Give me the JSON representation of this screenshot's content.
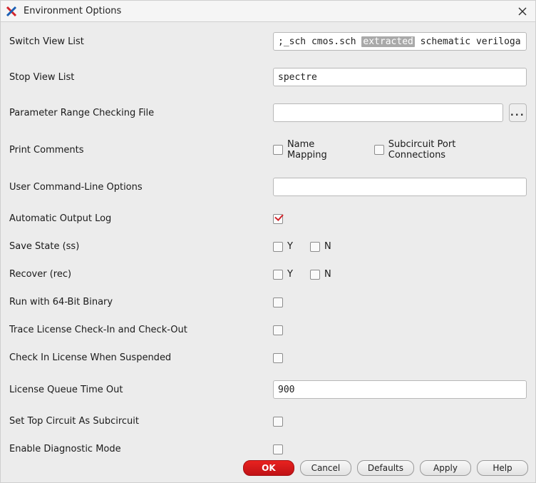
{
  "window": {
    "title": "Environment Options"
  },
  "fields": {
    "switch_view_list": {
      "label": "Switch View List",
      "prefix": ";_sch cmos.sch ",
      "selected": "extracted",
      "suffix": " schematic veriloga"
    },
    "stop_view_list": {
      "label": "Stop View List",
      "value": "spectre"
    },
    "param_range_file": {
      "label": "Parameter Range Checking File",
      "value": "",
      "browse": "..."
    },
    "print_comments": {
      "label": "Print Comments",
      "name_mapping": {
        "label": "Name Mapping",
        "checked": false
      },
      "subcircuit_port": {
        "label": "Subcircuit Port Connections",
        "checked": false
      }
    },
    "user_cli": {
      "label": "User Command-Line Options",
      "value": ""
    },
    "auto_output_log": {
      "label": "Automatic Output Log",
      "checked": true
    },
    "save_state": {
      "label": "Save State (ss)",
      "y": {
        "label": "Y",
        "checked": false
      },
      "n": {
        "label": "N",
        "checked": false
      }
    },
    "recover": {
      "label": "Recover (rec)",
      "y": {
        "label": "Y",
        "checked": false
      },
      "n": {
        "label": "N",
        "checked": false
      }
    },
    "run_64bit": {
      "label": "Run with 64-Bit Binary",
      "checked": false
    },
    "trace_license": {
      "label": "Trace License Check-In and Check-Out",
      "checked": false
    },
    "checkin_suspended": {
      "label": "Check In License When Suspended",
      "checked": false
    },
    "license_queue_timeout": {
      "label": "License Queue Time Out",
      "value": "900"
    },
    "set_top_subcircuit": {
      "label": "Set Top Circuit As Subcircuit",
      "checked": false
    },
    "enable_diag": {
      "label": "Enable Diagnostic Mode",
      "checked": false
    }
  },
  "buttons": {
    "ok": "OK",
    "cancel": "Cancel",
    "defaults": "Defaults",
    "apply": "Apply",
    "help": "Help"
  }
}
